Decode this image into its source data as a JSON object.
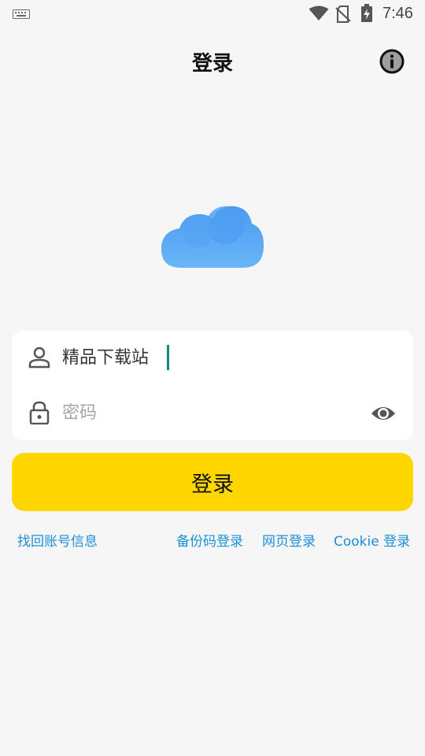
{
  "status_bar": {
    "time": "7:46",
    "icons": [
      "keyboard-icon",
      "wifi-icon",
      "no-sim-icon",
      "battery-charging-icon"
    ]
  },
  "header": {
    "title": "登录",
    "info_icon": "info-icon"
  },
  "logo": {
    "icon": "cloud-icon",
    "color": "#5aa9f5"
  },
  "form": {
    "username": {
      "icon": "user-icon",
      "value": "精品下载站"
    },
    "password": {
      "icon": "lock-icon",
      "placeholder": "密码",
      "value": "",
      "toggle_icon": "eye-icon"
    }
  },
  "login_button": {
    "label": "登录",
    "color": "#ffd600"
  },
  "links": {
    "recover": "找回账号信息",
    "backup_code": "备份码登录",
    "web": "网页登录",
    "cookie": "Cookie 登录",
    "color": "#1b8fd8"
  }
}
